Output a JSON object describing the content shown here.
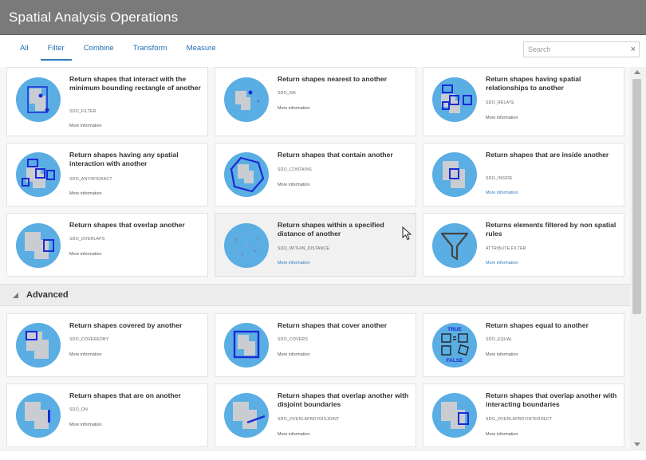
{
  "window": {
    "title": "Spatial Analysis Operations"
  },
  "tabs": [
    {
      "label": "All",
      "active": false
    },
    {
      "label": "Filter",
      "active": true
    },
    {
      "label": "Combine",
      "active": false
    },
    {
      "label": "Transform",
      "active": false
    },
    {
      "label": "Measure",
      "active": false
    }
  ],
  "search": {
    "placeholder": "Search",
    "value": "",
    "clear": "×"
  },
  "cards": [
    {
      "title": "Return shapes that interact with the minimum bounding rectangle of another",
      "code": "SDO_FILTER",
      "more": "More information",
      "icon": "filter-mbr-icon"
    },
    {
      "title": "Return shapes nearest to another",
      "code": "SDO_NN",
      "more": "More information",
      "icon": "nearest-neighbor-icon"
    },
    {
      "title": "Return shapes having spatial relationships to another",
      "code": "SDO_RELATE",
      "more": "More information",
      "icon": "relate-icon"
    },
    {
      "title": "Return shapes having any spatial interaction with another",
      "code": "SDO_ANYINTERACT",
      "more": "More information",
      "icon": "any-interact-icon"
    },
    {
      "title": "Return shapes that contain another",
      "code": "SDO_CONTAINS",
      "more": "More information",
      "icon": "contains-icon"
    },
    {
      "title": "Return shapes that are inside another",
      "code": "SDO_INSIDE",
      "more": "More information",
      "icon": "inside-icon"
    },
    {
      "title": "Return shapes that overlap another",
      "code": "SDO_OVERLAPS",
      "more": "More information",
      "icon": "overlaps-icon"
    },
    {
      "title": "Return shapes within a specified distance of another",
      "code": "SDO_WITHIN_DISTANCE",
      "more": "More information",
      "icon": "within-distance-icon"
    },
    {
      "title": "Returns elements filtered by non spatial rules",
      "code": "ATTRIBUTE FILTER",
      "more": "More information",
      "icon": "funnel-icon"
    }
  ],
  "advanced": {
    "label": "Advanced",
    "cards": [
      {
        "title": "Return shapes covered by another",
        "code": "SDO_COVEREDBY",
        "more": "More information",
        "icon": "covered-by-icon"
      },
      {
        "title": "Return shapes that cover another",
        "code": "SDO_COVERS",
        "more": "More information",
        "icon": "covers-icon"
      },
      {
        "title": "Return shapes equal to another",
        "code": "SDO_EQUAL",
        "more": "More information",
        "icon": "equal-icon",
        "icon_text_top": "TRUE",
        "icon_text_bottom": "FALSE"
      },
      {
        "title": "Return shapes that are on another",
        "code": "SDO_ON",
        "more": "More information",
        "icon": "on-icon"
      },
      {
        "title": "Return shapes that overlap another with disjoint boundaries",
        "code": "SDO_OVERLAPBDYDISJOINT",
        "more": "More information",
        "icon": "overlap-disjoint-icon"
      },
      {
        "title": "Return shapes that overlap another with interacting boundaries",
        "code": "SDO_OVERLAPBDYINTERSECT",
        "more": "More information",
        "icon": "overlap-intersect-icon"
      }
    ]
  },
  "colors": {
    "titlebar": "#7a7a7a",
    "accent": "#2b7bc0",
    "icon_circle": "#5aaee3",
    "icon_shape": "#c9cdd2",
    "icon_outline": "#1a2bd6"
  }
}
